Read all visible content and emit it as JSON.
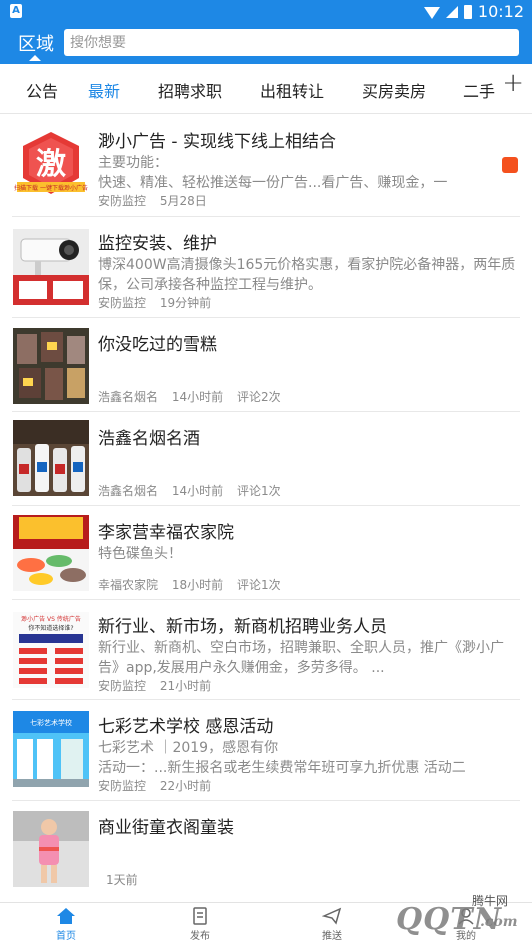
{
  "status": {
    "time": "10:12"
  },
  "header": {
    "region_label": "区域",
    "search_placeholder": "搜你想要"
  },
  "tabs": [
    "公告",
    "最新",
    "招聘求职",
    "出租转让",
    "买房卖房",
    "二手"
  ],
  "active_tab": 1,
  "items": [
    {
      "title": "渺小广告 - 实现线下线上相结合",
      "desc": "主要功能：\n快速、精准、轻松推送每一份广告...看广告、赚现金，一",
      "category": "安防监控",
      "time": "5月28日",
      "comments": ""
    },
    {
      "title": "监控安装、维护",
      "desc": "博深400W高清摄像头165元价格实惠，看家护院必备神器，两年质保，公司承接各种监控工程与维护。",
      "category": "安防监控",
      "time": "19分钟前",
      "comments": ""
    },
    {
      "title": "你没吃过的雪糕",
      "desc": "",
      "category": "浩鑫名烟名",
      "time": "14小时前",
      "comments": "评论2次"
    },
    {
      "title": "浩鑫名烟名酒",
      "desc": "",
      "category": "浩鑫名烟名",
      "time": "14小时前",
      "comments": "评论1次"
    },
    {
      "title": "李家营幸福农家院",
      "desc": "特色碟鱼头！",
      "category": "幸福农家院",
      "time": "18小时前",
      "comments": "评论1次"
    },
    {
      "title": "新行业、新市场，新商机招聘业务人员",
      "desc": "新行业、新商机、空白市场，招聘兼职、全职人员，推广《渺小广告》app,发展用户永久赚佣金，多劳多得。 ...",
      "category": "安防监控",
      "time": "21小时前",
      "comments": ""
    },
    {
      "title": "七彩艺术学校 感恩活动",
      "desc": " 七彩艺术 ｜2019，感恩有你\n活动一：...新生报名或老生续费常年班可享九折优惠 活动二",
      "category": "安防监控",
      "time": "22小时前",
      "comments": ""
    },
    {
      "title": "商业街童衣阁童装",
      "desc": "",
      "category": "",
      "time": "1天前",
      "comments": ""
    }
  ],
  "thumb_texts": {
    "ad_char": "激",
    "ad_ribbon": "扫描下载 一键下载渺小广告",
    "poster_brand": "渺小广告 VS 传统广告",
    "poster_q": "你不知道选择谁?",
    "school": "七彩艺术学校"
  },
  "bottom_nav": [
    "首页",
    "发布",
    "推送",
    "我的"
  ],
  "watermark": {
    "brand": "腾牛网",
    "logo": "QQTN",
    "domain": ".com"
  },
  "colors": {
    "primary": "#1e88e5",
    "text": "#222222",
    "muted": "#8a8a8a"
  }
}
